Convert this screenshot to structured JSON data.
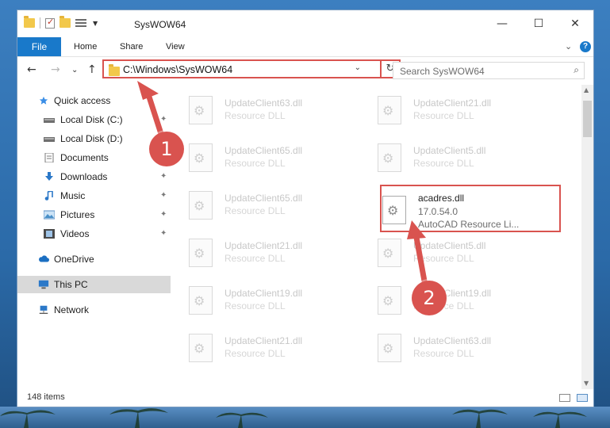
{
  "window": {
    "title": "SysWOW64",
    "controls": {
      "minimize": "—",
      "maximize": "☐",
      "close": "✕"
    }
  },
  "ribbon": {
    "file": "File",
    "tabs": [
      "Home",
      "Share",
      "View"
    ],
    "expand": "⌄",
    "help": "?"
  },
  "nav": {
    "back": "←",
    "forward": "→",
    "recent": "⌄",
    "up": "↑",
    "address": "C:\\Windows\\SysWOW64",
    "address_dropdown": "⌄",
    "refresh": "↻",
    "search_placeholder": "Search SysWOW64",
    "search_icon": "⌕"
  },
  "sidebar": {
    "items": [
      {
        "label": "Quick access",
        "icon": "star-icon"
      },
      {
        "label": "Local Disk (C:)",
        "icon": "drive-icon"
      },
      {
        "label": "Local Disk (D:)",
        "icon": "drive-icon"
      },
      {
        "label": "Documents",
        "icon": "documents-icon"
      },
      {
        "label": "Downloads",
        "icon": "download-icon"
      },
      {
        "label": "Music",
        "icon": "music-icon"
      },
      {
        "label": "Pictures",
        "icon": "pictures-icon"
      },
      {
        "label": "Videos",
        "icon": "videos-icon"
      },
      {
        "label": "OneDrive",
        "icon": "cloud-icon"
      },
      {
        "label": "This PC",
        "icon": "computer-icon"
      },
      {
        "label": "Network",
        "icon": "network-icon"
      }
    ],
    "pin_glyph": "📌"
  },
  "files": {
    "left": [
      {
        "name": "UpdateClient63.dll",
        "type": "Resource DLL"
      },
      {
        "name": "UpdateClient65.dll",
        "type": "Resource DLL"
      },
      {
        "name": "UpdateClient65.dll",
        "type": "Resource DLL"
      },
      {
        "name": "UpdateClient21.dll",
        "type": "Resource DLL"
      },
      {
        "name": "UpdateClient19.dll",
        "type": "Resource DLL"
      },
      {
        "name": "UpdateClient21.dll",
        "type": "Resource DLL"
      }
    ],
    "right": [
      {
        "name": "UpdateClient21.dll",
        "type": "Resource DLL"
      },
      {
        "name": "UpdateClient5.dll",
        "type": "Resource DLL"
      },
      {
        "name": "UpdateClient5.dll",
        "type": "Resource DLL"
      },
      {
        "name": "UpdateClient19.dll",
        "type": "Resource DLL"
      },
      {
        "name": "UpdateClient63.dll",
        "type": "Resource DLL"
      }
    ],
    "selected": {
      "name": "acadres.dll",
      "version": "17.0.54.0",
      "description": "AutoCAD Resource Li..."
    }
  },
  "status": {
    "count": "148 items"
  },
  "callouts": {
    "one": "1",
    "two": "2"
  },
  "colors": {
    "accent": "#1979ca",
    "highlight": "#d9534f"
  }
}
